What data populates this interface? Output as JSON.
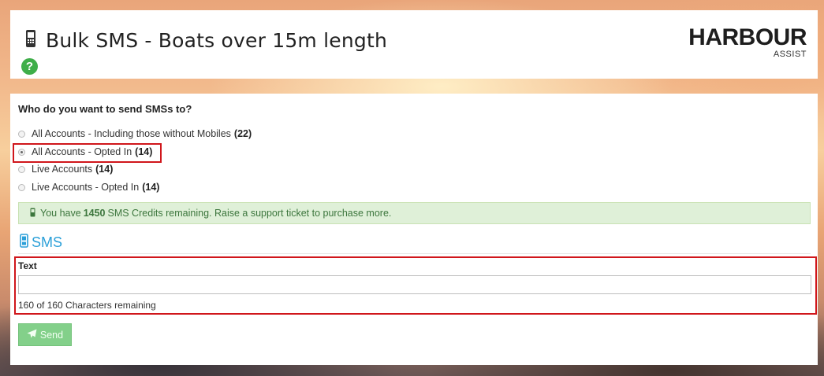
{
  "header": {
    "title": "Bulk SMS - Boats over 15m length",
    "help_glyph": "?",
    "logo_text": "HARBOUR",
    "logo_subtext": "ASSIST"
  },
  "form": {
    "question": "Who do you want to send SMSs to?",
    "options": [
      {
        "label": "All Accounts - Including those without Mobiles",
        "count": "(22)",
        "selected": false
      },
      {
        "label": "All Accounts - Opted In",
        "count": "(14)",
        "selected": true
      },
      {
        "label": "Live Accounts",
        "count": "(14)",
        "selected": false
      },
      {
        "label": "Live Accounts - Opted In",
        "count": "(14)",
        "selected": false
      }
    ],
    "credits": {
      "prefix": "You have",
      "amount": "1450",
      "suffix": "SMS Credits remaining. Raise a support ticket to purchase more."
    },
    "section_title": "SMS",
    "text_label": "Text",
    "text_value": "",
    "chars_remaining": "160 of 160 Characters remaining",
    "send_label": "Send"
  },
  "icons": {
    "title_icon": "mobile-phone-icon",
    "help_icon": "question-circle-icon",
    "credits_icon": "mobile-phone-icon",
    "section_icon": "mobile-phone-icon",
    "send_icon": "paper-plane-icon"
  },
  "colors": {
    "highlight": "#d0161b",
    "accent": "#2a9fd8",
    "help": "#3fae49",
    "send_button": "#83d08a",
    "alert_bg": "#dff0d8",
    "alert_text": "#3c763d"
  }
}
